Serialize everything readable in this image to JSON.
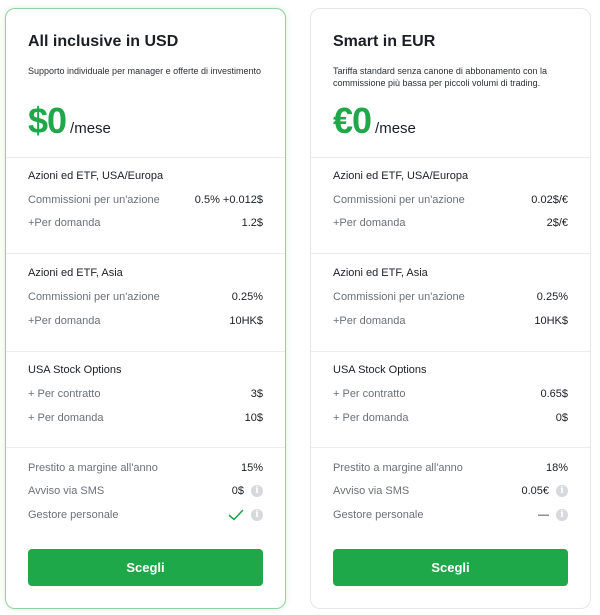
{
  "plans": [
    {
      "title": "All inclusive in USD",
      "description": "Supporto individuale per manager e offerte di investimento",
      "price": "$0",
      "price_unit": "/mese",
      "sections": [
        {
          "title": "Azioni ed ETF, USA/Europa",
          "rows": [
            {
              "label": "Commissioni per un'azione",
              "value": "0.5% +0.012$"
            },
            {
              "label": "+Per domanda",
              "value": "1.2$"
            }
          ]
        },
        {
          "title": "Azioni ed ETF, Asia",
          "rows": [
            {
              "label": "Commissioni per un'azione",
              "value": "0.25%"
            },
            {
              "label": "+Per domanda",
              "value": "10HK$"
            }
          ]
        },
        {
          "title": "USA Stock Options",
          "rows": [
            {
              "label": "+ Per contratto",
              "value": "3$"
            },
            {
              "label": "+ Per domanda",
              "value": "10$"
            }
          ]
        }
      ],
      "extras": [
        {
          "label": "Prestito a margine all'anno",
          "value": "15%"
        },
        {
          "label": "Avviso via SMS",
          "value": "0$"
        },
        {
          "label": "Gestore personale",
          "value": ""
        }
      ],
      "cta": "Scegli"
    },
    {
      "title": "Smart in EUR",
      "description": "Tariffa standard senza canone di abbonamento con la commissione più bassa per piccoli volumi di trading.",
      "price": "€0",
      "price_unit": "/mese",
      "sections": [
        {
          "title": "Azioni ed ETF, USA/Europa",
          "rows": [
            {
              "label": "Commissioni per un'azione",
              "value": "0.02$/€"
            },
            {
              "label": "+Per domanda",
              "value": "2$/€"
            }
          ]
        },
        {
          "title": "Azioni ed ETF, Asia",
          "rows": [
            {
              "label": "Commissioni per un'azione",
              "value": "0.25%"
            },
            {
              "label": "+Per domanda",
              "value": "10HK$"
            }
          ]
        },
        {
          "title": "USA Stock Options",
          "rows": [
            {
              "label": "+ Per contratto",
              "value": "0.65$"
            },
            {
              "label": "+ Per domanda",
              "value": "0$"
            }
          ]
        }
      ],
      "extras": [
        {
          "label": "Prestito a margine all'anno",
          "value": "18%"
        },
        {
          "label": "Avviso via SMS",
          "value": "0.05€"
        },
        {
          "label": "Gestore personale",
          "value": "—"
        }
      ],
      "cta": "Scegli"
    }
  ],
  "colors": {
    "accent": "#1fa849",
    "highlight_border": "#8fd3a0",
    "info_icon": "#d6d9dc"
  },
  "icons": {
    "info": "info-icon",
    "check": "check-icon"
  }
}
